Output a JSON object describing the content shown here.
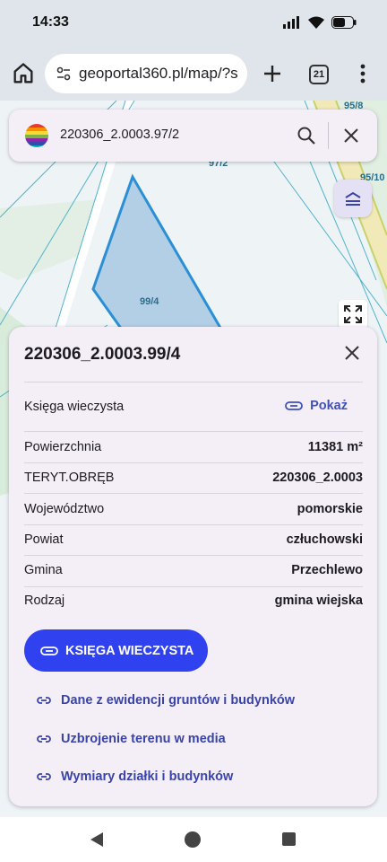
{
  "status_bar": {
    "time": "14:33"
  },
  "browser": {
    "url": "geoportal360.pl/map/?s",
    "tab_count": "21"
  },
  "map": {
    "labels": [
      "95/8",
      "97/2",
      "95/10",
      "99/4"
    ]
  },
  "search": {
    "value": "220306_2.0003.97/2"
  },
  "panel": {
    "title": "220306_2.0003.99/4",
    "kw_row": {
      "label": "Księga wieczysta",
      "action": "Pokaż"
    },
    "rows": [
      {
        "label": "Powierzchnia",
        "value": "11381 m²"
      },
      {
        "label": "TERYT.OBRĘB",
        "value": "220306_2.0003"
      },
      {
        "label": "Województwo",
        "value": "pomorskie"
      },
      {
        "label": "Powiat",
        "value": "człuchowski"
      },
      {
        "label": "Gmina",
        "value": "Przechlewo"
      },
      {
        "label": "Rodzaj",
        "value": "gmina wiejska"
      }
    ],
    "kw_button": "KSIĘGA WIECZYSTA",
    "links": [
      "Dane z ewidencji gruntów i budynków",
      "Uzbrojenie terenu w media",
      "Wymiary działki i budynków"
    ]
  },
  "colors": {
    "accent": "#3041f0",
    "parcel_fill": "#b3cfe6",
    "parcel_stroke": "#2b8fd6",
    "link": "#3a43a8"
  }
}
